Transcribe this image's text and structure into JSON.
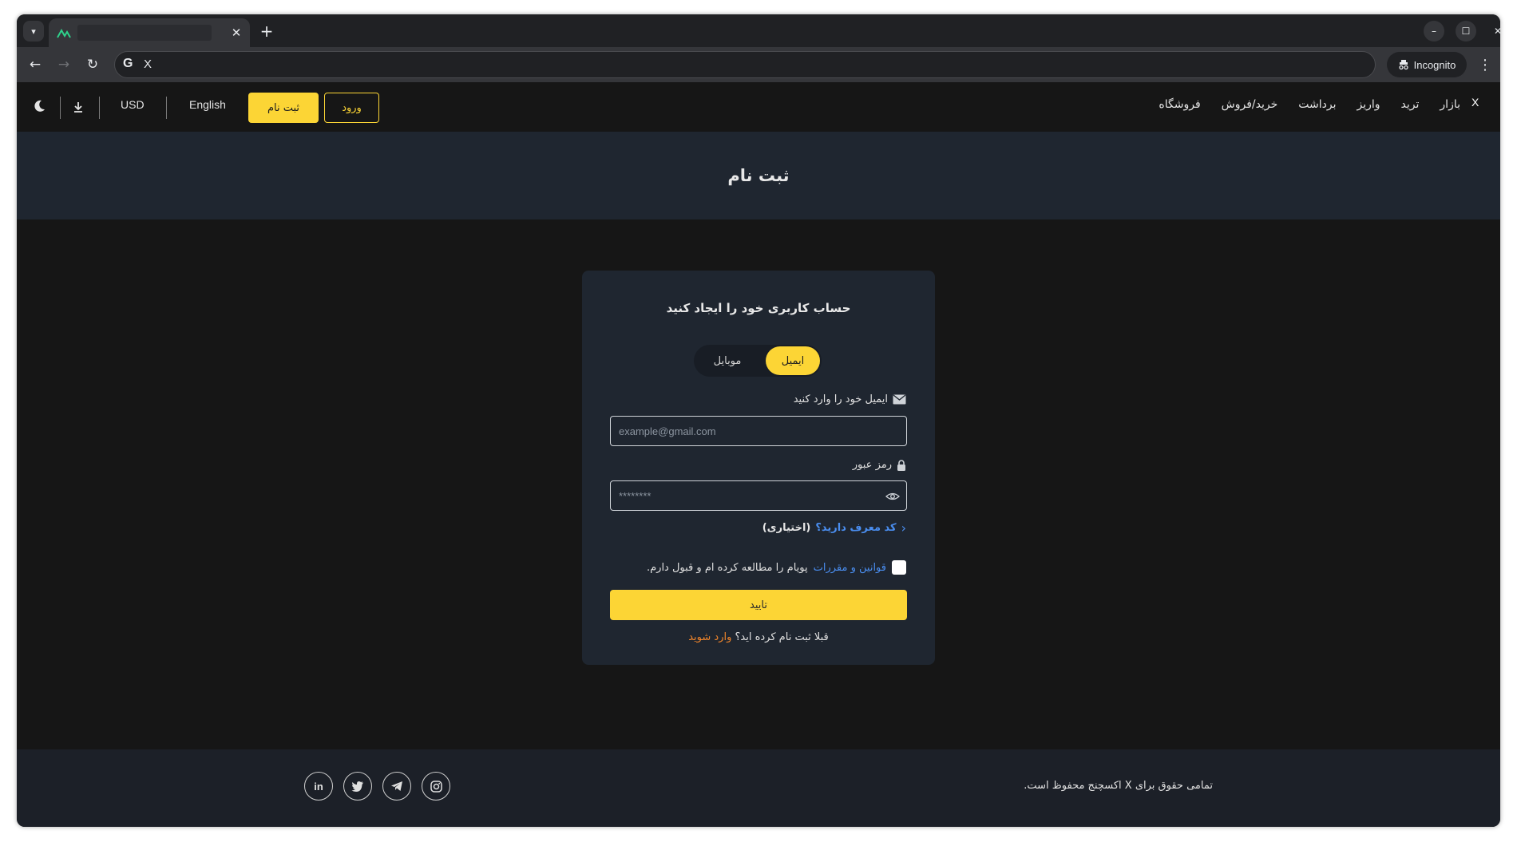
{
  "browser": {
    "tab_close_glyph": "✕",
    "new_tab_glyph": "+",
    "omnibox_text": "X",
    "incognito_label": "Incognito",
    "minimize_glyph": "–",
    "maximize_glyph": "☐",
    "close_glyph": "✕",
    "menu_glyph": "⋮"
  },
  "header": {
    "brand": "X",
    "nav": [
      "بازار",
      "ترید",
      "واریز",
      "برداشت",
      "خرید/فروش",
      "فروشگاه"
    ],
    "currency": "USD",
    "language": "English",
    "register_label": "ثبت نام",
    "login_label": "ورود"
  },
  "banner": {
    "title": "ثبت نام"
  },
  "form": {
    "title": "حساب کاربری خود را ایجاد کنید",
    "tab_email": "ایمیل",
    "tab_mobile": "موبایل",
    "email_label": "ایمیل خود را وارد کنید",
    "email_placeholder": "example@gmail.com",
    "password_label": "رمز عبور",
    "password_placeholder": "********",
    "referral_question": "کد معرف دارید؟",
    "referral_optional": "(اختیاری)",
    "terms_link": "قوانین و مقررات",
    "terms_text": "پویام را مطالعه کرده ام و قبول دارم.",
    "submit_label": "تایید",
    "already_text": "قبلا ثبت نام کرده اید؟",
    "login_link": "وارد شوید"
  },
  "footer": {
    "copyright": "تمامی حقوق برای X اکسچنج محفوظ است.",
    "socials": [
      "linkedin-icon",
      "twitter-icon",
      "telegram-icon",
      "instagram-icon"
    ]
  },
  "colors": {
    "accent": "#fcd535",
    "link": "#4a8ef0",
    "login_link": "#f0852b",
    "card": "#1f2630",
    "background": "#161616"
  }
}
